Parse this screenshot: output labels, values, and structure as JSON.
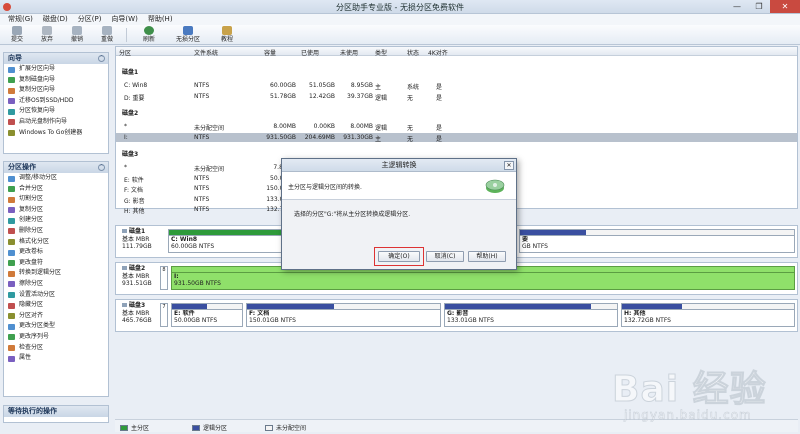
{
  "window": {
    "title": "分区助手专业版 - 无损分区免费软件",
    "minimize": "—",
    "maximize": "❐",
    "close": "✕"
  },
  "menu": [
    "常规(G)",
    "磁盘(D)",
    "分区(P)",
    "向导(W)",
    "帮助(H)"
  ],
  "toolbar": {
    "items": [
      {
        "label": "提交",
        "icon": "commit-icon"
      },
      {
        "label": "放弃",
        "icon": "discard-icon"
      },
      {
        "label": "撤销",
        "icon": "undo-icon"
      },
      {
        "label": "重做",
        "icon": "redo-icon"
      },
      {
        "label": "刷新",
        "icon": "refresh-icon"
      },
      {
        "label": "无损分区",
        "icon": "partition-icon"
      },
      {
        "label": "教程",
        "icon": "tutorial-icon"
      }
    ]
  },
  "wizard_panel": {
    "title": "向导",
    "items": [
      "扩展分区向导",
      "复制磁盘向导",
      "复制分区向导",
      "迁移OS到SSD/HDD",
      "分区恢复向导",
      "启动光盘制作向导",
      "Windows To Go创建器"
    ]
  },
  "ops_panel": {
    "title": "分区操作",
    "items": [
      "调整/移动分区",
      "合并分区",
      "切割分区",
      "复制分区",
      "创建分区",
      "删除分区",
      "格式化分区",
      "更改卷标",
      "更改盘符",
      "转换到逻辑分区",
      "擦除分区",
      "设置活动分区",
      "隐藏分区",
      "分区对齐",
      "更改分区类型",
      "更改序列号",
      "检查分区",
      "属性"
    ]
  },
  "pending_panel": {
    "title": "等待执行的操作"
  },
  "list": {
    "columns": [
      "分区",
      "文件系统",
      "容量",
      "已使用",
      "未使用",
      "类型",
      "状态",
      "4K对齐"
    ],
    "disks": [
      {
        "name": "磁盘1",
        "rows": [
          [
            "C: Win8",
            "NTFS",
            "60.00GB",
            "51.05GB",
            "8.95GB",
            "主",
            "系统",
            "是"
          ],
          [
            "D: 重要",
            "NTFS",
            "51.78GB",
            "12.42GB",
            "39.37GB",
            "逻辑",
            "无",
            "是"
          ]
        ]
      },
      {
        "name": "磁盘2",
        "rows": [
          [
            "*",
            "未分配空间",
            "8.00MB",
            "0.00KB",
            "8.00MB",
            "逻辑",
            "无",
            "是"
          ],
          [
            "I:",
            "NTFS",
            "931.50GB",
            "204.69MB",
            "931.30GB",
            "主",
            "无",
            "是"
          ]
        ]
      },
      {
        "name": "磁盘3",
        "rows": [
          [
            "*",
            "未分配空间",
            "7.84MB",
            "",
            "",
            "",
            "",
            ""
          ],
          [
            "E: 软件",
            "NTFS",
            "50.00GB",
            "",
            "",
            "",
            "",
            ""
          ],
          [
            "F: 文档",
            "NTFS",
            "150.01GB",
            "",
            "",
            "",
            "",
            ""
          ],
          [
            "G: 影音",
            "NTFS",
            "133.01GB",
            "",
            "",
            "",
            "",
            ""
          ],
          [
            "H: 其他",
            "NTFS",
            "132.72GB",
            "",
            "",
            "",
            "",
            ""
          ]
        ]
      }
    ]
  },
  "disk_maps": [
    {
      "name": "磁盘1",
      "type": "基本 MBR",
      "size": "111.79GB",
      "parts": [
        {
          "label": "C: Win8",
          "detail": "60.00GB NTFS",
          "used": 0.85
        },
        {
          "label": "要",
          "detail": "GB NTFS",
          "used": 0.24
        }
      ]
    },
    {
      "name": "磁盘2",
      "type": "基本 MBR",
      "size": "931.51GB",
      "expander": "8",
      "parts": [
        {
          "label": "I:",
          "detail": "931.50GB NTFS",
          "used": 0.01
        }
      ]
    },
    {
      "name": "磁盘3",
      "type": "基本 MBR",
      "size": "465.76GB",
      "expander": "7",
      "parts": [
        {
          "label": "E: 软件",
          "detail": "50.00GB NTFS",
          "used": 0.5
        },
        {
          "label": "F: 文档",
          "detail": "150.01GB NTFS",
          "used": 0.45
        },
        {
          "label": "G: 影音",
          "detail": "133.01GB NTFS",
          "used": 0.85
        },
        {
          "label": "H: 其他",
          "detail": "132.72GB NTFS",
          "used": 0.35
        }
      ]
    }
  ],
  "legend": [
    {
      "label": "主分区",
      "color": "#2e9a3a"
    },
    {
      "label": "逻辑分区",
      "color": "#3a4fa0"
    },
    {
      "label": "未分配空间",
      "color": "#f4f4f4"
    }
  ],
  "dialog": {
    "title": "主逻辑转换",
    "heading": "主分区与逻辑分区间的转换.",
    "message": "选择的分区\"G:\"将从主分区转换成逻辑分区.",
    "ok": "确定(O)",
    "cancel": "取消(C)",
    "help": "帮助(H)",
    "close": "✕"
  },
  "colors": {
    "primary": "#2e9a3a",
    "logical": "#3a4fa0",
    "selected_green": "#8fe06a",
    "highlight_ring": "#dd3333"
  },
  "watermark": {
    "brand": "Bai 经验",
    "url": "jingyan.baidu.com"
  }
}
